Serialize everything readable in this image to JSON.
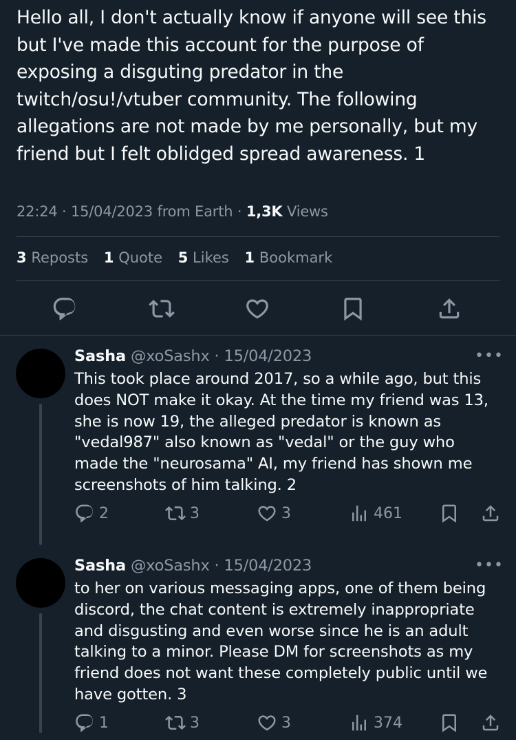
{
  "tweet": {
    "text": "Hello all, I don't actually know if anyone will see this but I've made this account for the purpose of exposing a disguting predator in the twitch/osu!/vtuber community. The following allegations are not made by me personally, but my friend but I felt oblidged spread awareness. 1",
    "time": "22:24",
    "date": "15/04/2023",
    "source": "from Earth",
    "views_count": "1,3K",
    "views_label": "Views",
    "stats": {
      "reposts_count": "3",
      "reposts_label": "Reposts",
      "quotes_count": "1",
      "quotes_label": "Quote",
      "likes_count": "5",
      "likes_label": "Likes",
      "bookmarks_count": "1",
      "bookmarks_label": "Bookmark"
    },
    "actions": [
      "reply-icon",
      "repost-icon",
      "like-icon",
      "bookmark-icon",
      "share-icon"
    ]
  },
  "replies": [
    {
      "name": "Sasha",
      "handle": "@xoSashx",
      "date": "15/04/2023",
      "more": "•••",
      "text": "This took place around 2017, so a while ago, but this does NOT make it okay. At the time my friend was 13, she is now 19, the alleged predator is known as \"vedal987\" also known as \"vedal\" or the guy who made the \"neurosama\" AI, my friend has shown me screenshots of him talking. 2",
      "replies": "2",
      "reposts": "3",
      "likes": "3",
      "views": "461"
    },
    {
      "name": "Sasha",
      "handle": "@xoSashx",
      "date": "15/04/2023",
      "more": "•••",
      "text": "to her on various messaging apps, one of them being discord, the chat content is extremely inappropriate and disgusting and even worse since he is an adult talking to a minor. Please DM for screenshots as my friend does not want these completely public until we have gotten. 3",
      "replies": "1",
      "reposts": "3",
      "likes": "3",
      "views": "374"
    }
  ],
  "colors": {
    "background": "#15202b",
    "text": "#f7f9f9",
    "muted": "#8b98a5",
    "divider": "#38444d"
  }
}
